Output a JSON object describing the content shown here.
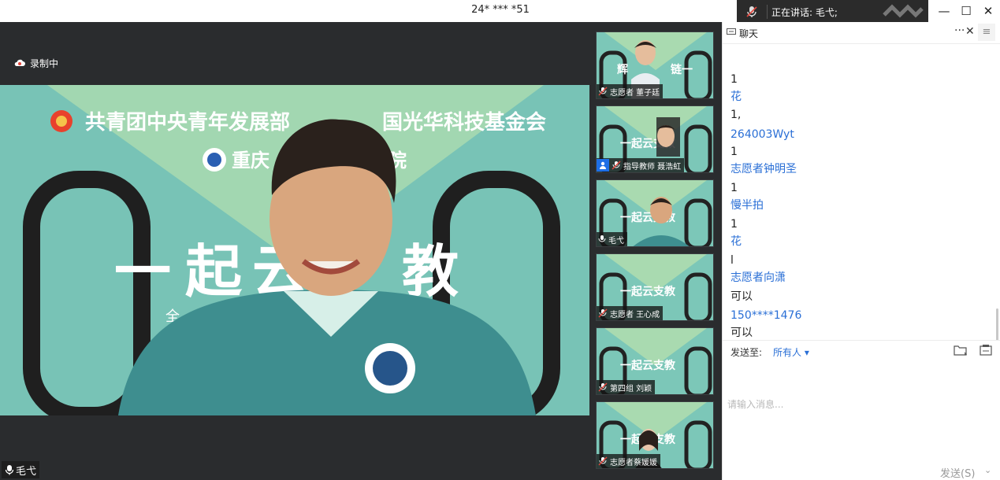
{
  "window": {
    "title": "24* *** *51",
    "speaking_label": "正在讲话: 毛弋;",
    "minimize": "—",
    "maximize": "☐",
    "close": "✕"
  },
  "main_video": {
    "recording_label": "录制中",
    "speaker_name": "毛弋",
    "banner": {
      "org_left": "共青团中央青年发展部",
      "org_right": "国光华科技基金会",
      "school": "重庆",
      "school_right": "院",
      "slogan_chars": [
        "一",
        "起",
        "云",
        "教"
      ],
      "subtitle": "全"
    }
  },
  "participants": [
    {
      "name": "志愿者 董子廷",
      "host": false,
      "mic": "muted"
    },
    {
      "name": "指导教师 聂浩虹",
      "host": true,
      "mic": "muted"
    },
    {
      "name": "毛弋",
      "host": false,
      "mic": "on"
    },
    {
      "name": "志愿者 王心成",
      "host": false,
      "mic": "muted"
    },
    {
      "name": "第四组 刘颖",
      "host": false,
      "mic": "muted"
    },
    {
      "name": "志愿者蔡媛媛",
      "host": false,
      "mic": "muted"
    }
  ],
  "thumb_banner": {
    "slogan": "一起云支教",
    "partial_slogan_1": "辉",
    "partial_slogan_2": "链一"
  },
  "chat": {
    "title": "聊天",
    "more": "···",
    "close": "✕",
    "side_toggle": "≡",
    "messages": [
      {
        "kind": "body",
        "text": "1"
      },
      {
        "kind": "sender",
        "text": "花"
      },
      {
        "kind": "body",
        "text": "1,"
      },
      {
        "kind": "sender",
        "text": "264003Wyt"
      },
      {
        "kind": "body",
        "text": "1"
      },
      {
        "kind": "sender",
        "text": "志愿者钟明圣"
      },
      {
        "kind": "body",
        "text": "1"
      },
      {
        "kind": "sender",
        "text": "慢半拍"
      },
      {
        "kind": "body",
        "text": "1"
      },
      {
        "kind": "sender",
        "text": "花"
      },
      {
        "kind": "body",
        "text": "l"
      },
      {
        "kind": "sender",
        "text": "志愿者向潇"
      },
      {
        "kind": "body",
        "text": "可以"
      },
      {
        "kind": "sender",
        "text": "150****1476"
      },
      {
        "kind": "body",
        "text": "可以"
      }
    ],
    "send_to_label": "发送至:",
    "send_to_value": "所有人 ▾",
    "input_placeholder": "请输入消息...",
    "send_button": "发送(S)",
    "send_dropdown": "⌄"
  },
  "colors": {
    "dark_bg": "#2a2c2e",
    "banner_green": "#8ecab3",
    "banner_teal": "#6fbfb4",
    "link_blue": "#2a6fd6",
    "host_badge": "#1e6fe6"
  }
}
